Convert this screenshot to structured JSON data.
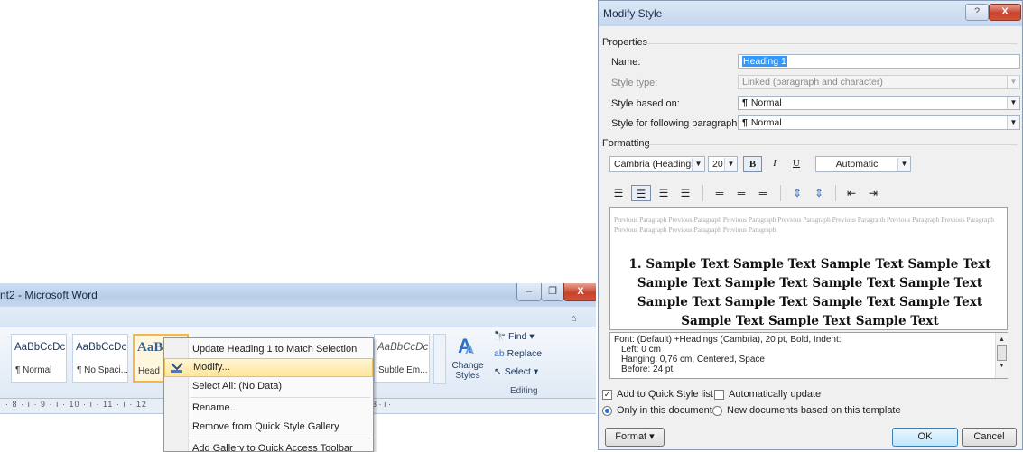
{
  "word": {
    "title": "nt2 - Microsoft Word",
    "window_buttons": {
      "minimize": "–",
      "maximize": "❐",
      "close": "X"
    },
    "help_glyph": "⌂",
    "styles": [
      {
        "sample": "AaBbCcDc",
        "label": "¶ Normal"
      },
      {
        "sample": "AaBbCcDc",
        "label": "¶ No Spaci..."
      },
      {
        "sample": "AaB",
        "label": "Head"
      },
      {
        "sample": "AaBbCcDc",
        "label": "Subtle Em..."
      }
    ],
    "change_styles": {
      "label": "Change Styles",
      "icon": "change-styles-icon"
    },
    "editing": {
      "find": "Find",
      "replace": "Replace",
      "select": "Select",
      "group_label": "Editing"
    },
    "ruler_text": "· 8 · ı · 9 · ı · 10 · ı · 11 · ı · 12",
    "ruler_tail": "3 · ı ·"
  },
  "context_menu": {
    "items": [
      {
        "label": "Update Heading 1 to Match Selection",
        "icon": "",
        "highlight": false
      },
      {
        "label": "Modify...",
        "icon": "modify-icon",
        "highlight": true
      },
      {
        "label": "Select All: (No Data)",
        "icon": "",
        "highlight": false
      },
      {
        "label": "Rename...",
        "icon": "",
        "highlight": false
      },
      {
        "label": "Remove from Quick Style Gallery",
        "icon": "",
        "highlight": false
      },
      {
        "label": "Add Gallery to Quick Access Toolbar",
        "icon": "",
        "highlight": false
      }
    ]
  },
  "dialog": {
    "title": "Modify Style",
    "help_glyph": "?",
    "close_glyph": "X",
    "properties": {
      "group": "Properties",
      "name_label": "Name:",
      "name_value": "Heading 1",
      "type_label": "Style type:",
      "type_value": "Linked (paragraph and character)",
      "based_label": "Style based on:",
      "based_value": "Normal",
      "following_label": "Style for following paragraph:",
      "following_value": "Normal"
    },
    "formatting": {
      "group": "Formatting",
      "font": "Cambria (Headings)",
      "size": "20",
      "bold": "B",
      "italic": "I",
      "underline": "U",
      "color": "Automatic"
    },
    "preview": {
      "previous": "Previous Paragraph Previous Paragraph Previous Paragraph Previous Paragraph Previous Paragraph Previous Paragraph Previous Paragraph Previous Paragraph Previous Paragraph Previous Paragraph",
      "sample": "1. Sample Text Sample Text Sample Text Sample Text Sample Text Sample Text Sample Text Sample Text Sample Text Sample Text Sample Text Sample Text Sample Text Sample Text Sample Text"
    },
    "description": [
      "Font: (Default) +Headings (Cambria), 20 pt, Bold, Indent:",
      "Left:  0 cm",
      "Hanging:  0,76 cm, Centered, Space",
      "Before:  24 pt"
    ],
    "add_quick_style": "Add to Quick Style list",
    "auto_update": "Automatically update",
    "only_doc": "Only in this document",
    "new_docs": "New documents based on this template",
    "format_btn": "Format ▾",
    "ok": "OK",
    "cancel": "Cancel"
  }
}
